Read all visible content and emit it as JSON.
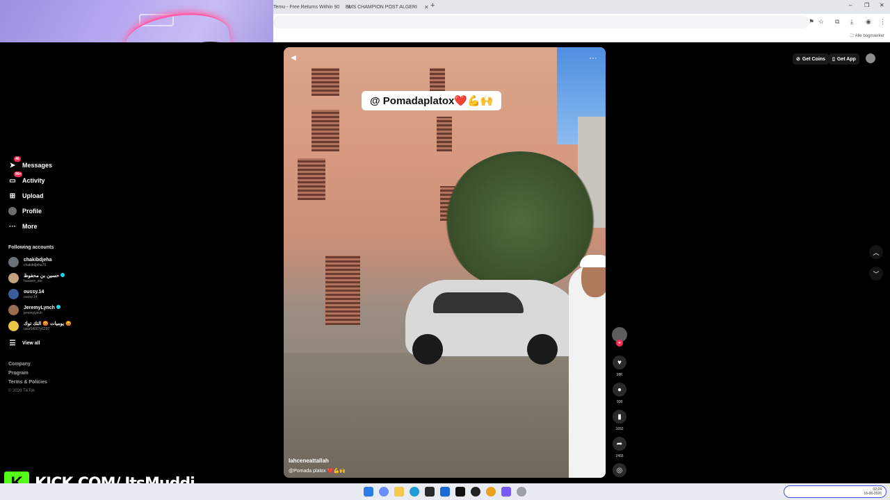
{
  "browser": {
    "tabs": [
      {
        "label": "Temu - Free Returns Within 90"
      },
      {
        "label": "EMS CHAMPION POST ALGERI"
      }
    ],
    "bookmarks_all": "Alle bogmærker"
  },
  "sidebar": {
    "nav": [
      {
        "label": "Messages",
        "badge": "46",
        "icon": "paper-plane-icon"
      },
      {
        "label": "Activity",
        "badge": "99+",
        "icon": "inbox-icon"
      },
      {
        "label": "Upload",
        "badge": "",
        "icon": "plus-square-icon"
      },
      {
        "label": "Profile",
        "badge": "",
        "icon": "avatar-icon"
      },
      {
        "label": "More",
        "badge": "",
        "icon": "dots-icon"
      }
    ],
    "following_title": "Following accounts",
    "accounts": [
      {
        "name": "chakibdjeha",
        "handle": "chakibdjeha79",
        "verified": false
      },
      {
        "name": "حسين بن محفوظ",
        "handle": "hussein_sm",
        "verified": true
      },
      {
        "name": "oussy.14",
        "handle": "oussy.14",
        "verified": false
      },
      {
        "name": "JeremyLynch",
        "handle": "jeremylynch",
        "verified": true
      },
      {
        "name": "يوميات 😡 التك توك 😡",
        "handle": "user54067y6297",
        "verified": false
      }
    ],
    "view_all": "View all",
    "footer": [
      "Company",
      "Program",
      "Terms & Policies"
    ],
    "copyright": "© 2026 TikTok"
  },
  "video": {
    "sticker": "@ Pomadaplatox❤️💪🙌",
    "author": "lahceneattallah",
    "caption": "@Pomada platox ❤️💪🙌"
  },
  "actions": {
    "likes": "38K",
    "comments": "938",
    "saves": "1652",
    "shares": "2456"
  },
  "header": {
    "get_coins": "Get Coins",
    "get_app": "Get App"
  },
  "overlay": {
    "kick_logo": "K",
    "kick_text": "KICK.COM/ ItsMuddi"
  },
  "taskbar": {
    "time": "02:24",
    "date": "16-06-2026"
  }
}
